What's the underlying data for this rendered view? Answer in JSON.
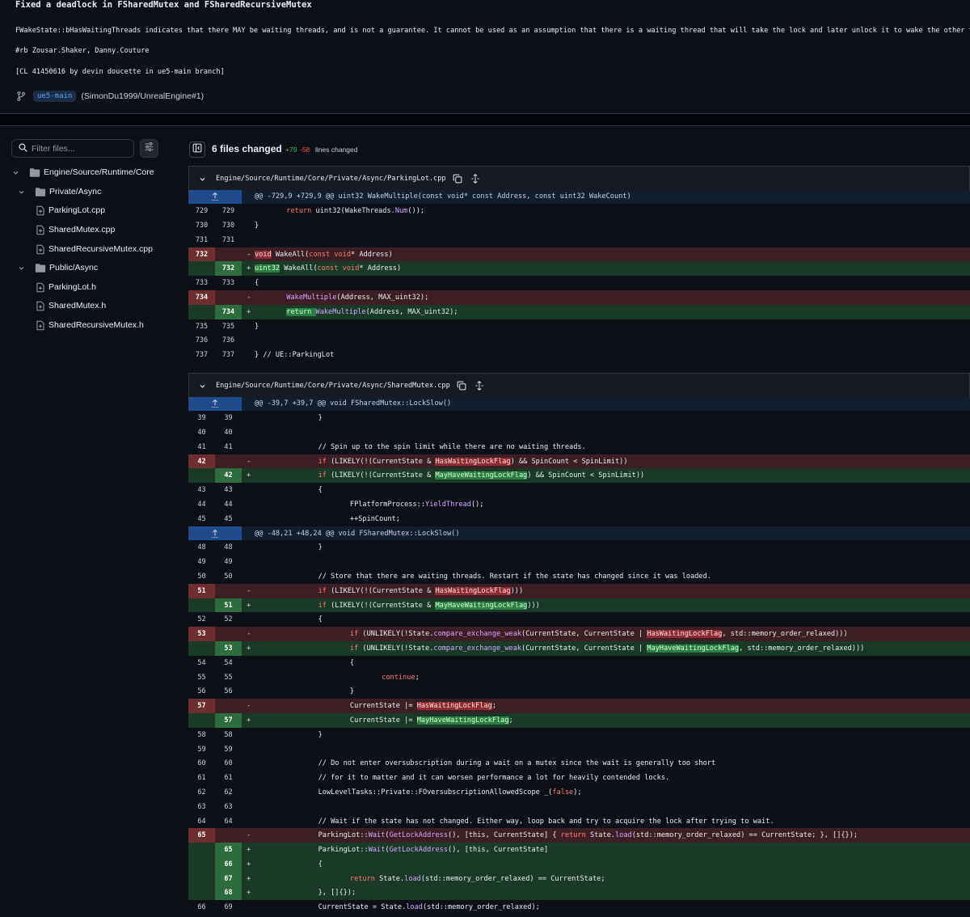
{
  "commit": {
    "title": "Fixed a deadlock in FSharedMutex and FSharedRecursiveMutex",
    "body": "FWakeState::bHasWaitingThreads indicates that there MAY be waiting threads, and is not a guarantee. It cannot be used as an assumption that there is a waiting thread that will take the lock and later unlock it to wake the other threads.",
    "reviewers": "#rb Zousar.Shaker, Danny.Couture",
    "cl": "[CL 41450616 by devin doucette in ue5-main branch]",
    "branch": "ue5-main",
    "repo_ref": "(SimonDu1999/UnrealEngine#1)"
  },
  "sidebar": {
    "filter_placeholder": "Filter files...",
    "tree": [
      {
        "label": "Engine/Source/Runtime/Core",
        "kind": "folder"
      },
      {
        "label": "Private/Async",
        "kind": "folder"
      },
      {
        "label": "ParkingLot.cpp",
        "kind": "file"
      },
      {
        "label": "SharedMutex.cpp",
        "kind": "file"
      },
      {
        "label": "SharedRecursiveMutex.cpp",
        "kind": "file"
      },
      {
        "label": "Public/Async",
        "kind": "folder"
      },
      {
        "label": "ParkingLot.h",
        "kind": "file"
      },
      {
        "label": "SharedMutex.h",
        "kind": "file"
      },
      {
        "label": "SharedRecursiveMutex.h",
        "kind": "file"
      }
    ]
  },
  "summary": {
    "files_changed": "6 files changed",
    "additions": "+79",
    "deletions": "-58",
    "lines_changed": "lines changed"
  },
  "files": [
    {
      "path": "Engine/Source/Runtime/Core/Private/Async/ParkingLot.cpp",
      "rows": [
        {
          "type": "hunk",
          "text": "@@ -729,9 +729,9 @@ uint32 WakeMultiple(const void* const Address, const uint32 WakeCount)"
        },
        {
          "type": "ctx",
          "l": "729",
          "r": "729",
          "indent": 1,
          "parts": [
            [
              "kw",
              "return "
            ],
            [
              "",
              "uint32("
            ],
            [
              "",
              "WakeThreads."
            ],
            [
              "fn",
              "Num"
            ],
            [
              "",
              "());"
            ]
          ]
        },
        {
          "type": "ctx",
          "l": "730",
          "r": "730",
          "indent": 0,
          "parts": [
            [
              "",
              "}"
            ]
          ]
        },
        {
          "type": "ctx",
          "l": "731",
          "r": "731",
          "indent": 0,
          "parts": []
        },
        {
          "type": "del",
          "l": "732",
          "r": "",
          "indent": 0,
          "parts": [
            [
              "hd",
              "void"
            ],
            [
              "",
              " WakeAll("
            ],
            [
              "kw",
              "const "
            ],
            [
              "kw",
              "void"
            ],
            [
              "",
              "* Address)"
            ]
          ]
        },
        {
          "type": "add",
          "l": "",
          "r": "732",
          "indent": 0,
          "parts": [
            [
              "ha",
              "uint32"
            ],
            [
              "",
              " WakeAll("
            ],
            [
              "kw",
              "const "
            ],
            [
              "kw",
              "void"
            ],
            [
              "",
              "* Address)"
            ]
          ]
        },
        {
          "type": "ctx",
          "l": "733",
          "r": "733",
          "indent": 0,
          "parts": [
            [
              "",
              "{"
            ]
          ]
        },
        {
          "type": "del",
          "l": "734",
          "r": "",
          "indent": 1,
          "parts": [
            [
              "fn",
              "WakeMultiple"
            ],
            [
              "",
              "(Address, MAX_uint32);"
            ]
          ]
        },
        {
          "type": "add",
          "l": "",
          "r": "734",
          "indent": 1,
          "parts": [
            [
              "ha",
              "return "
            ],
            [
              "fn",
              "WakeMultiple"
            ],
            [
              "",
              "(Address, MAX_uint32);"
            ]
          ]
        },
        {
          "type": "ctx",
          "l": "735",
          "r": "735",
          "indent": 0,
          "parts": [
            [
              "",
              "}"
            ]
          ]
        },
        {
          "type": "ctx",
          "l": "736",
          "r": "736",
          "indent": 0,
          "parts": []
        },
        {
          "type": "ctx",
          "l": "737",
          "r": "737",
          "indent": 0,
          "parts": [
            [
              "",
              "} // UE::ParkingLot"
            ]
          ]
        }
      ]
    },
    {
      "path": "Engine/Source/Runtime/Core/Private/Async/SharedMutex.cpp",
      "rows": [
        {
          "type": "hunk",
          "text": "@@ -39,7 +39,7 @@ void FSharedMutex::LockSlow()"
        },
        {
          "type": "ctx",
          "l": "39",
          "r": "39",
          "indent": 2,
          "parts": [
            [
              "",
              "}"
            ]
          ]
        },
        {
          "type": "ctx",
          "l": "40",
          "r": "40",
          "indent": 0,
          "parts": []
        },
        {
          "type": "ctx",
          "l": "41",
          "r": "41",
          "indent": 2,
          "parts": [
            [
              "",
              "// Spin up to the spin limit while there are no waiting threads."
            ]
          ]
        },
        {
          "type": "del",
          "l": "42",
          "r": "",
          "indent": 2,
          "parts": [
            [
              "kw",
              "if "
            ],
            [
              "",
              "(LIKELY(!(CurrentState & "
            ],
            [
              "hd",
              "HasWaitingLockFlag"
            ],
            [
              "",
              ") && SpinCount < SpinLimit))"
            ]
          ]
        },
        {
          "type": "add",
          "l": "",
          "r": "42",
          "indent": 2,
          "parts": [
            [
              "kw",
              "if "
            ],
            [
              "",
              "(LIKELY(!(CurrentState & "
            ],
            [
              "ha",
              "MayHaveWaitingLockFlag"
            ],
            [
              "",
              ") && SpinCount < SpinLimit))"
            ]
          ]
        },
        {
          "type": "ctx",
          "l": "43",
          "r": "43",
          "indent": 2,
          "parts": [
            [
              "",
              "{"
            ]
          ]
        },
        {
          "type": "ctx",
          "l": "44",
          "r": "44",
          "indent": 3,
          "parts": [
            [
              "",
              "FPlatformProcess::"
            ],
            [
              "fn",
              "YieldThread"
            ],
            [
              "",
              "();"
            ]
          ]
        },
        {
          "type": "ctx",
          "l": "45",
          "r": "45",
          "indent": 3,
          "parts": [
            [
              "",
              "++SpinCount;"
            ]
          ]
        },
        {
          "type": "hunk",
          "text": "@@ -48,21 +48,24 @@ void FSharedMutex::LockSlow()"
        },
        {
          "type": "ctx",
          "l": "48",
          "r": "48",
          "indent": 2,
          "parts": [
            [
              "",
              "}"
            ]
          ]
        },
        {
          "type": "ctx",
          "l": "49",
          "r": "49",
          "indent": 0,
          "parts": []
        },
        {
          "type": "ctx",
          "l": "50",
          "r": "50",
          "indent": 2,
          "parts": [
            [
              "",
              "// Store that there are waiting threads. Restart if the state has changed since it was loaded."
            ]
          ]
        },
        {
          "type": "del",
          "l": "51",
          "r": "",
          "indent": 2,
          "parts": [
            [
              "kw",
              "if "
            ],
            [
              "",
              "(LIKELY(!(CurrentState & "
            ],
            [
              "hd",
              "HasWaitingLockFlag"
            ],
            [
              "",
              ")))"
            ]
          ]
        },
        {
          "type": "add",
          "l": "",
          "r": "51",
          "indent": 2,
          "parts": [
            [
              "kw",
              "if "
            ],
            [
              "",
              "(LIKELY(!(CurrentState & "
            ],
            [
              "ha",
              "MayHaveWaitingLockFlag"
            ],
            [
              "",
              ")))"
            ]
          ]
        },
        {
          "type": "ctx",
          "l": "52",
          "r": "52",
          "indent": 2,
          "parts": [
            [
              "",
              "{"
            ]
          ]
        },
        {
          "type": "del",
          "l": "53",
          "r": "",
          "indent": 3,
          "parts": [
            [
              "kw",
              "if "
            ],
            [
              "",
              "(UNLIKELY(!State."
            ],
            [
              "fn",
              "compare_exchange_weak"
            ],
            [
              "",
              "(CurrentState, CurrentState | "
            ],
            [
              "hd",
              "HasWaitingLockFlag"
            ],
            [
              "",
              ", std::memory_order_relaxed)))"
            ]
          ]
        },
        {
          "type": "add",
          "l": "",
          "r": "53",
          "indent": 3,
          "parts": [
            [
              "kw",
              "if "
            ],
            [
              "",
              "(UNLIKELY(!State."
            ],
            [
              "fn",
              "compare_exchange_weak"
            ],
            [
              "",
              "(CurrentState, CurrentState | "
            ],
            [
              "ha",
              "MayHaveWaitingLockFlag"
            ],
            [
              "",
              ", std::memory_order_relaxed)))"
            ]
          ]
        },
        {
          "type": "ctx",
          "l": "54",
          "r": "54",
          "indent": 3,
          "parts": [
            [
              "",
              "{"
            ]
          ]
        },
        {
          "type": "ctx",
          "l": "55",
          "r": "55",
          "indent": 4,
          "parts": [
            [
              "kw",
              "continue"
            ],
            [
              "",
              ";"
            ]
          ]
        },
        {
          "type": "ctx",
          "l": "56",
          "r": "56",
          "indent": 3,
          "parts": [
            [
              "",
              "}"
            ]
          ]
        },
        {
          "type": "del",
          "l": "57",
          "r": "",
          "indent": 3,
          "parts": [
            [
              "",
              "CurrentState |= "
            ],
            [
              "hd",
              "HasWaitingLockFlag"
            ],
            [
              "",
              ";"
            ]
          ]
        },
        {
          "type": "add",
          "l": "",
          "r": "57",
          "indent": 3,
          "parts": [
            [
              "",
              "CurrentState |= "
            ],
            [
              "ha",
              "MayHaveWaitingLockFlag"
            ],
            [
              "",
              ";"
            ]
          ]
        },
        {
          "type": "ctx",
          "l": "58",
          "r": "58",
          "indent": 2,
          "parts": [
            [
              "",
              "}"
            ]
          ]
        },
        {
          "type": "ctx",
          "l": "59",
          "r": "59",
          "indent": 0,
          "parts": []
        },
        {
          "type": "ctx",
          "l": "60",
          "r": "60",
          "indent": 2,
          "parts": [
            [
              "",
              "// Do not enter oversubscription during a wait on a mutex since the wait is generally too short"
            ]
          ]
        },
        {
          "type": "ctx",
          "l": "61",
          "r": "61",
          "indent": 2,
          "parts": [
            [
              "",
              "// for it to matter and it can worsen performance a lot for heavily contended locks."
            ]
          ]
        },
        {
          "type": "ctx",
          "l": "62",
          "r": "62",
          "indent": 2,
          "parts": [
            [
              "",
              "LowLevelTasks::Private::FOversubscriptionAllowedScope _("
            ],
            [
              "kw",
              "false"
            ],
            [
              "",
              ");"
            ]
          ]
        },
        {
          "type": "ctx",
          "l": "63",
          "r": "63",
          "indent": 0,
          "parts": []
        },
        {
          "type": "ctx",
          "l": "64",
          "r": "64",
          "indent": 2,
          "parts": [
            [
              "",
              "// Wait if the state has not changed. Either way, loop back and try to acquire the lock after trying to wait."
            ]
          ]
        },
        {
          "type": "del",
          "l": "65",
          "r": "",
          "indent": 2,
          "parts": [
            [
              "",
              "ParkingLot::"
            ],
            [
              "fn",
              "Wait"
            ],
            [
              "",
              "("
            ],
            [
              "fn",
              "GetLockAddress"
            ],
            [
              "",
              "(), [this, CurrentState] { "
            ],
            [
              "kw",
              "return "
            ],
            [
              "",
              "State."
            ],
            [
              "fn",
              "load"
            ],
            [
              "",
              "(std::memory_order_relaxed) == CurrentState; }, []{});"
            ]
          ]
        },
        {
          "type": "add",
          "l": "",
          "r": "65",
          "indent": 2,
          "parts": [
            [
              "",
              "ParkingLot::"
            ],
            [
              "fn",
              "Wait"
            ],
            [
              "",
              "("
            ],
            [
              "fn",
              "GetLockAddress"
            ],
            [
              "",
              "(), [this, CurrentState]"
            ]
          ]
        },
        {
          "type": "add",
          "l": "",
          "r": "66",
          "indent": 2,
          "parts": [
            [
              "",
              "{"
            ]
          ]
        },
        {
          "type": "add",
          "l": "",
          "r": "67",
          "indent": 3,
          "parts": [
            [
              "kw",
              "return "
            ],
            [
              "",
              "State."
            ],
            [
              "fn",
              "load"
            ],
            [
              "",
              "(std::memory_order_relaxed) == CurrentState;"
            ]
          ]
        },
        {
          "type": "add",
          "l": "",
          "r": "68",
          "indent": 2,
          "parts": [
            [
              "",
              "}, []{});"
            ]
          ]
        },
        {
          "type": "ctx",
          "l": "66",
          "r": "69",
          "indent": 2,
          "parts": [
            [
              "",
              "CurrentState = State."
            ],
            [
              "fn",
              "load"
            ],
            [
              "",
              "(std::memory_order_relaxed);"
            ]
          ]
        }
      ]
    }
  ]
}
